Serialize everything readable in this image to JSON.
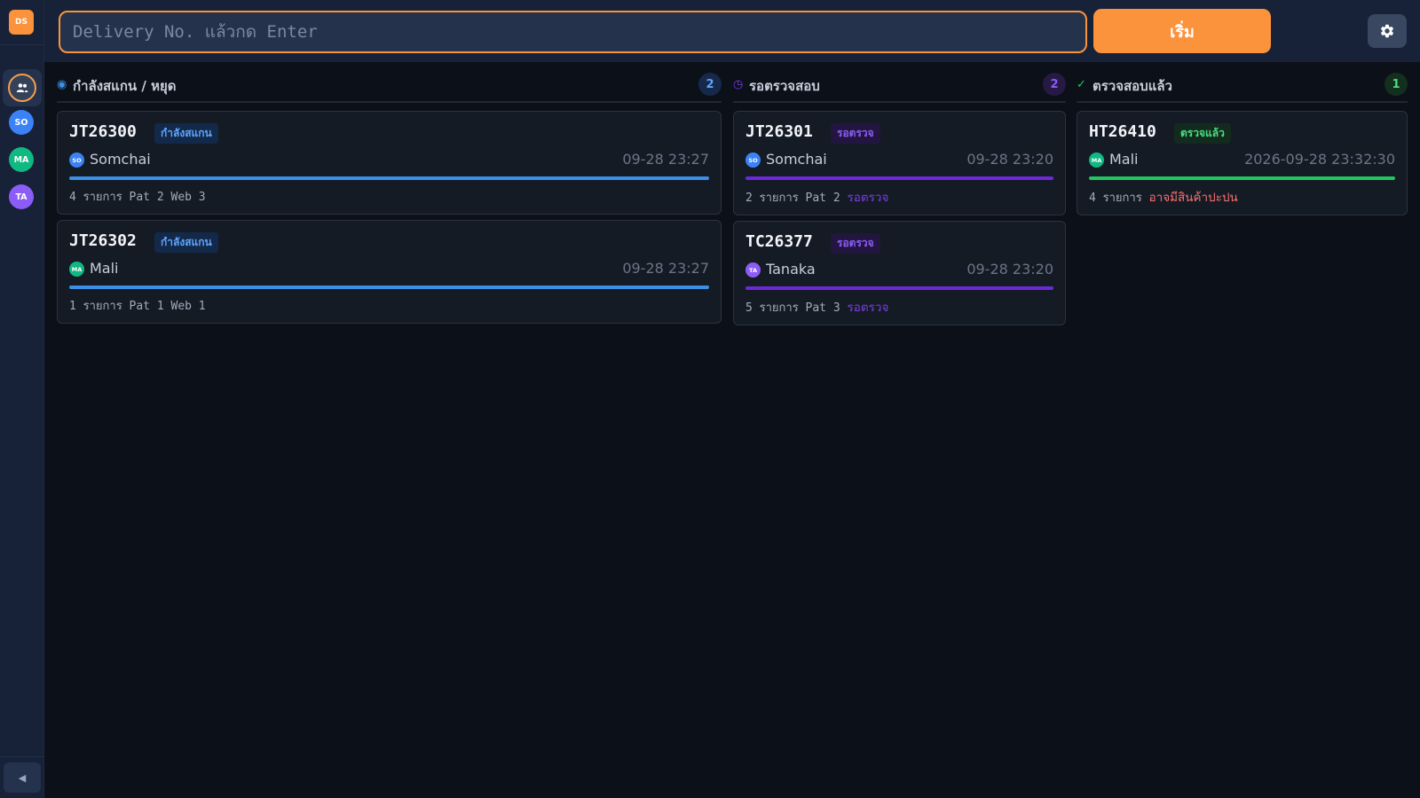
{
  "app": {
    "logo_text": "DS"
  },
  "sidebar": {
    "users": [
      {
        "initials": "SO",
        "color": "#3b82f6"
      },
      {
        "initials": "MA",
        "color": "#10b981"
      },
      {
        "initials": "TA",
        "color": "#8b5cf6"
      }
    ],
    "collapse_icon": "◀"
  },
  "topbar": {
    "search_placeholder": "Delivery No. แล้วกด Enter",
    "start_label": "เริ่ม"
  },
  "colors": {
    "accent": "#fb923c",
    "scanning": "#3b8fe6",
    "pending": "#6d28d9",
    "verified": "#22c55e",
    "alert": "#f87171"
  },
  "columns": {
    "scanning": {
      "icon": "◉",
      "title": "กำลังสแกน / หยุด",
      "count": "2",
      "cards": [
        {
          "dno": "JT26300",
          "badge": "กำลังสแกน",
          "initials": "SO",
          "user": "Somchai",
          "time": "09-28 23:27",
          "meta": "4 รายการ Pat 2 Web 3",
          "status": ""
        },
        {
          "dno": "JT26302",
          "badge": "กำลังสแกน",
          "initials": "MA",
          "user": "Mali",
          "time": "09-28 23:27",
          "meta": "1 รายการ Pat 1 Web 1",
          "status": ""
        }
      ]
    },
    "pending": {
      "icon": "◷",
      "title": "รอตรวจสอบ",
      "count": "2",
      "cards": [
        {
          "dno": "JT26301",
          "badge": "รอตรวจ",
          "initials": "SO",
          "user": "Somchai",
          "time": "09-28 23:20",
          "meta": "2 รายการ Pat 2",
          "status": "รอตรวจ"
        },
        {
          "dno": "TC26377",
          "badge": "รอตรวจ",
          "initials": "TA",
          "user": "Tanaka",
          "time": "09-28 23:20",
          "meta": "5 รายการ Pat 3",
          "status": "รอตรวจ"
        }
      ]
    },
    "verified": {
      "icon": "✓",
      "title": "ตรวจสอบแล้ว",
      "count": "1",
      "cards": [
        {
          "dno": "HT26410",
          "badge": "ตรวจแล้ว",
          "initials": "MA",
          "user": "Mali",
          "time": "2026-09-28 23:32:30",
          "meta": "4 รายการ",
          "status": "อาจมีสินค้าปะปน"
        }
      ]
    }
  }
}
